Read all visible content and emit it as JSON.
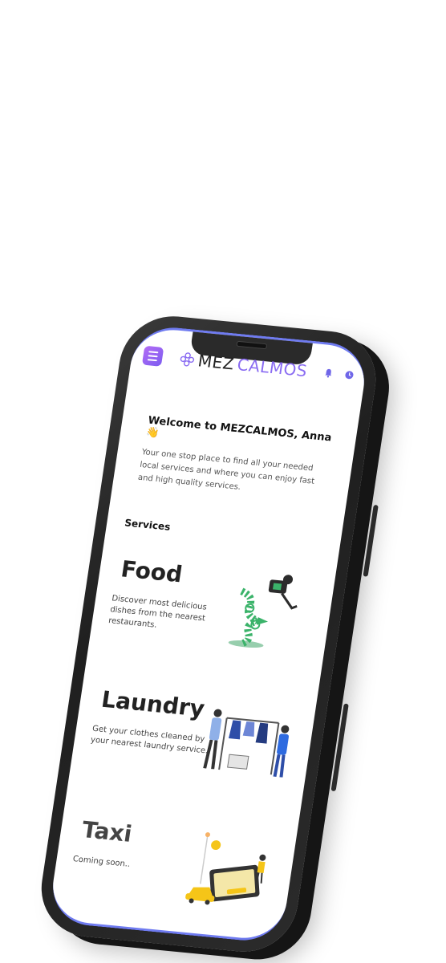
{
  "header": {
    "brand_part1": "MEZ",
    "brand_part2": "CALMOS"
  },
  "welcome": {
    "title": "Welcome to MEZCALMOS, Anna 👋",
    "tagline": "Your one stop place to find all your needed local services and where you can enjoy fast and high quality services."
  },
  "services": {
    "heading": "Services",
    "items": [
      {
        "title": "Food",
        "description": "Discover most delicious dishes from the nearest restaurants."
      },
      {
        "title": "Laundry",
        "description": "Get your clothes cleaned by your nearest laundry service."
      },
      {
        "title": "Taxi",
        "description": "Coming soon.."
      }
    ]
  },
  "colors": {
    "accent": "#8a6cf2",
    "menu_gradient_start": "#b36cf5",
    "menu_gradient_end": "#7c5cf0",
    "screen_border": "#6f7bf0"
  },
  "icons": [
    "menu-icon",
    "brand-logo-icon",
    "bell-icon",
    "clock-icon"
  ]
}
